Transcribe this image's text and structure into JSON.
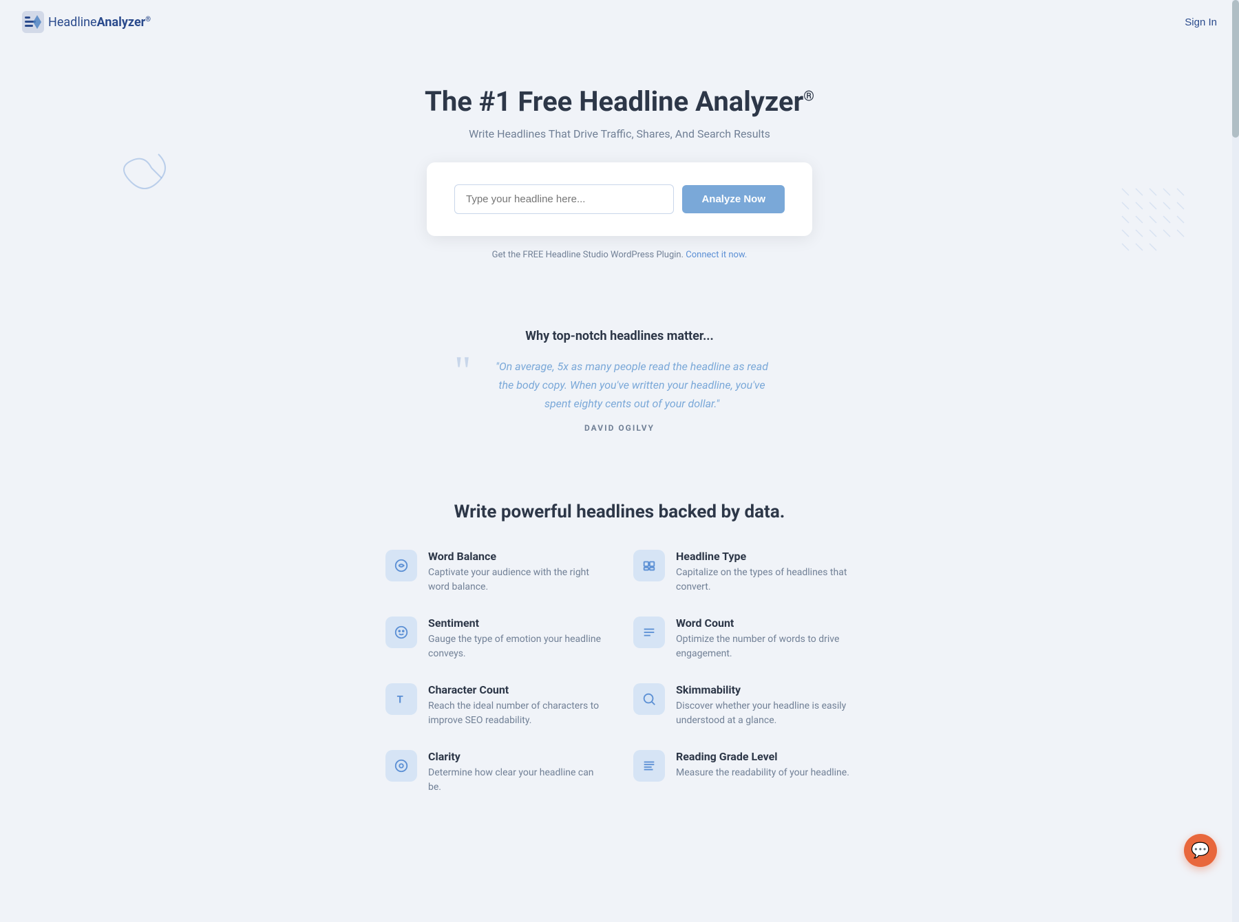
{
  "navbar": {
    "logo_text": "Headline",
    "logo_text2": "Analyzer",
    "logo_symbol": "®",
    "sign_in": "Sign In"
  },
  "hero": {
    "title": "The #1 Free Headline Analyzer",
    "title_symbol": "®",
    "subtitle": "Write Headlines That Drive Traffic, Shares, And Search Results",
    "input_placeholder": "Type your headline here...",
    "analyze_button": "Analyze Now",
    "plugin_notice_text": "Get the FREE Headline Studio WordPress Plugin.",
    "plugin_notice_link": "Connect it now."
  },
  "why_section": {
    "title": "Why top-notch headlines matter...",
    "quote": "\"On average, 5x as many people read the headline as read the body copy. When you've written your headline, you've spent eighty cents out of your dollar.\"",
    "author": "DAVID OGILVY"
  },
  "features_section": {
    "title": "Write powerful headlines backed by data.",
    "features": [
      {
        "id": "word-balance",
        "icon": "⊕",
        "name": "Word Balance",
        "description": "Captivate your audience with the right word balance."
      },
      {
        "id": "headline-type",
        "icon": "⊞",
        "name": "Headline Type",
        "description": "Capitalize on the types of headlines that convert."
      },
      {
        "id": "sentiment",
        "icon": "☺",
        "name": "Sentiment",
        "description": "Gauge the type of emotion your headline conveys."
      },
      {
        "id": "word-count",
        "icon": "☰",
        "name": "Word Count",
        "description": "Optimize the number of words to drive engagement."
      },
      {
        "id": "character-count",
        "icon": "T",
        "name": "Character Count",
        "description": "Reach the ideal number of characters to improve SEO readability."
      },
      {
        "id": "skimmability",
        "icon": "🔍",
        "name": "Skimmability",
        "description": "Discover whether your headline is easily understood at a glance."
      },
      {
        "id": "clarity",
        "icon": "◎",
        "name": "Clarity",
        "description": "Determine how clear your headline can be."
      },
      {
        "id": "reading-grade-level",
        "icon": "≡",
        "name": "Reading Grade Level",
        "description": "Measure the readability of your headline."
      }
    ]
  },
  "chat_button": {
    "label": "💬"
  },
  "sentiment_gauge": {
    "title": "Sentiment",
    "description": "Gauge the type of emotion your headline conveys"
  }
}
